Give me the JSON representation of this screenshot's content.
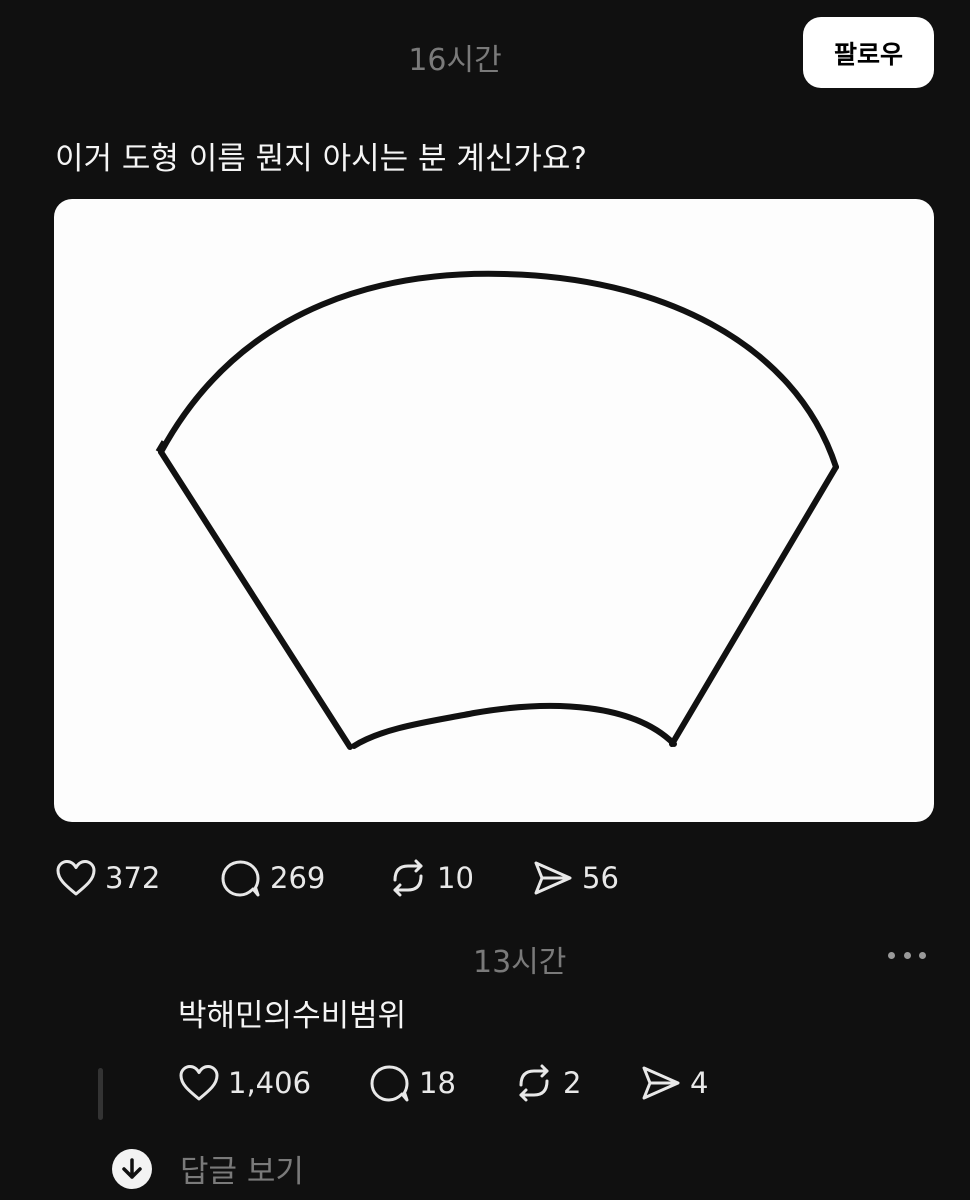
{
  "post": {
    "time": "16시간",
    "follow_label": "팔로우",
    "text": "이거 도형 이름 뭔지 아시는 분 계신가요?",
    "stats": {
      "likes": "372",
      "comments": "269",
      "reposts": "10",
      "shares": "56"
    }
  },
  "comment": {
    "time": "13시간",
    "text": "박해민의수비범위",
    "stats": {
      "likes": "1,406",
      "comments": "18",
      "reposts": "2",
      "shares": "4"
    }
  },
  "view_replies_label": "답글 보기",
  "icons": {
    "like": "heart-icon",
    "comment": "speech-bubble-icon",
    "repost": "repost-icon",
    "share": "send-icon",
    "more": "ellipsis-icon",
    "view_replies": "arrow-down-icon"
  },
  "colors": {
    "background": "#101010",
    "text": "#f3f3f3",
    "muted": "#7a7a7a",
    "follow_button": "#ffffff"
  }
}
